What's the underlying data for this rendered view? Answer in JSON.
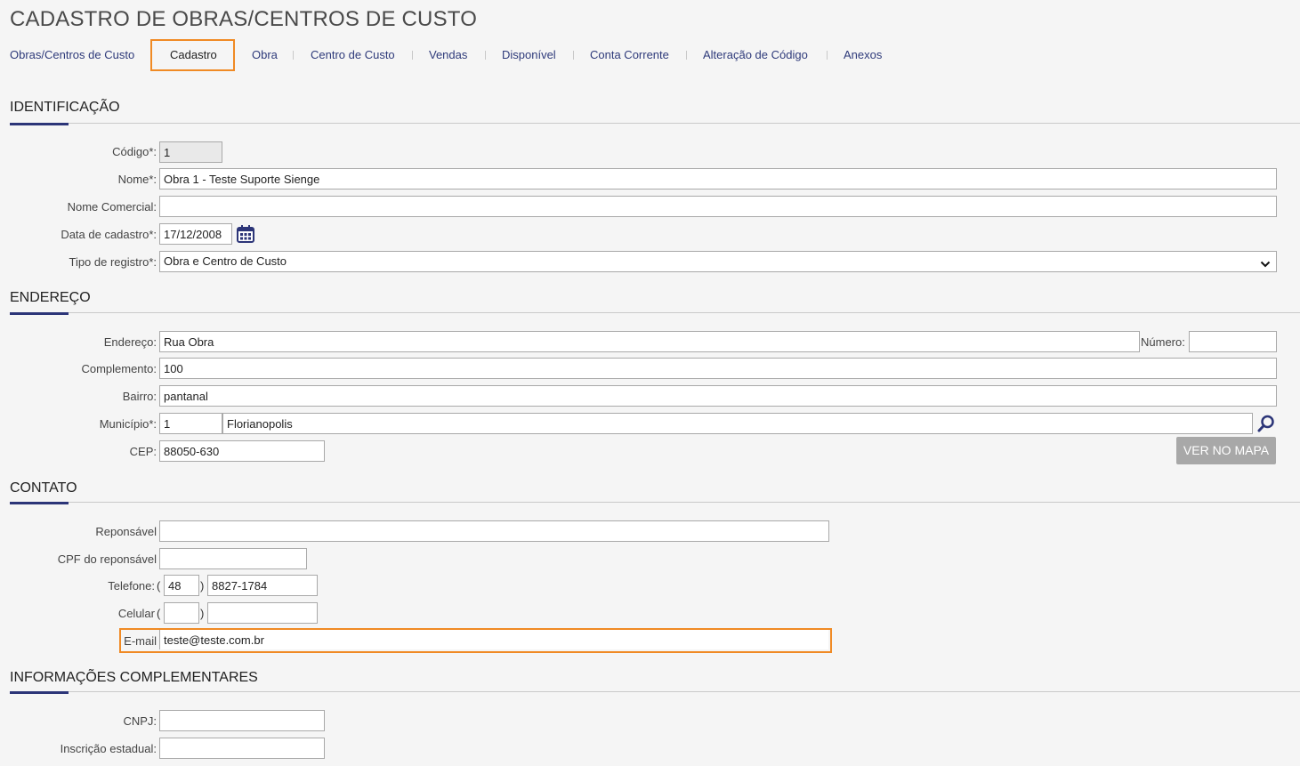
{
  "page": {
    "title": "CADASTRO DE OBRAS/CENTROS DE CUSTO"
  },
  "tabs": [
    {
      "label": "Obras/Centros de Custo"
    },
    {
      "label": "Cadastro",
      "active": true
    },
    {
      "label": "Obra"
    },
    {
      "label": "Centro de Custo"
    },
    {
      "label": "Vendas"
    },
    {
      "label": "Disponível"
    },
    {
      "label": "Conta Corrente"
    },
    {
      "label": "Alteração de Código"
    },
    {
      "label": "Anexos"
    }
  ],
  "identificacao": {
    "title": "IDENTIFICAÇÃO",
    "codigo_label": "Código*:",
    "codigo_value": "1",
    "nome_label": "Nome*:",
    "nome_value": "Obra 1 - Teste Suporte Sienge",
    "nome_comercial_label": "Nome Comercial:",
    "nome_comercial_value": "",
    "data_label": "Data de cadastro*:",
    "data_value": "17/12/2008",
    "tipo_label": "Tipo de registro*:",
    "tipo_value": "Obra e Centro de Custo"
  },
  "endereco": {
    "title": "ENDEREÇO",
    "endereco_label": "Endereço:",
    "endereco_value": "Rua Obra",
    "numero_label": "Número:",
    "numero_value": "",
    "complemento_label": "Complemento:",
    "complemento_value": "100",
    "bairro_label": "Bairro:",
    "bairro_value": "pantanal",
    "municipio_label": "Município*:",
    "municipio_code": "1",
    "municipio_name": "Florianopolis",
    "cep_label": "CEP:",
    "cep_value": "88050-630",
    "map_button": "VER NO MAPA"
  },
  "contato": {
    "title": "CONTATO",
    "responsavel_label": "Reponsável",
    "responsavel_value": "",
    "cpf_label": "CPF do reponsável",
    "cpf_value": "",
    "telefone_label": "Telefone:",
    "telefone_ddd": "48",
    "telefone_numero": "8827-1784",
    "celular_label": "Celular",
    "celular_ddd": "",
    "celular_numero": "",
    "email_label": "E-mail",
    "email_value": "teste@teste.com.br"
  },
  "complementares": {
    "title": "INFORMAÇÕES COMPLEMENTARES",
    "cnpj_label": "CNPJ:",
    "cnpj_value": "",
    "ie_label": "Inscrição estadual:",
    "ie_value": ""
  },
  "colors": {
    "accent_highlight": "#f08a24",
    "section_accent": "#2c3578",
    "tab_link": "#2e3a7a"
  },
  "icons": {
    "calendar": "calendar-icon",
    "search": "search-icon",
    "caret": "chevron-down-icon"
  }
}
